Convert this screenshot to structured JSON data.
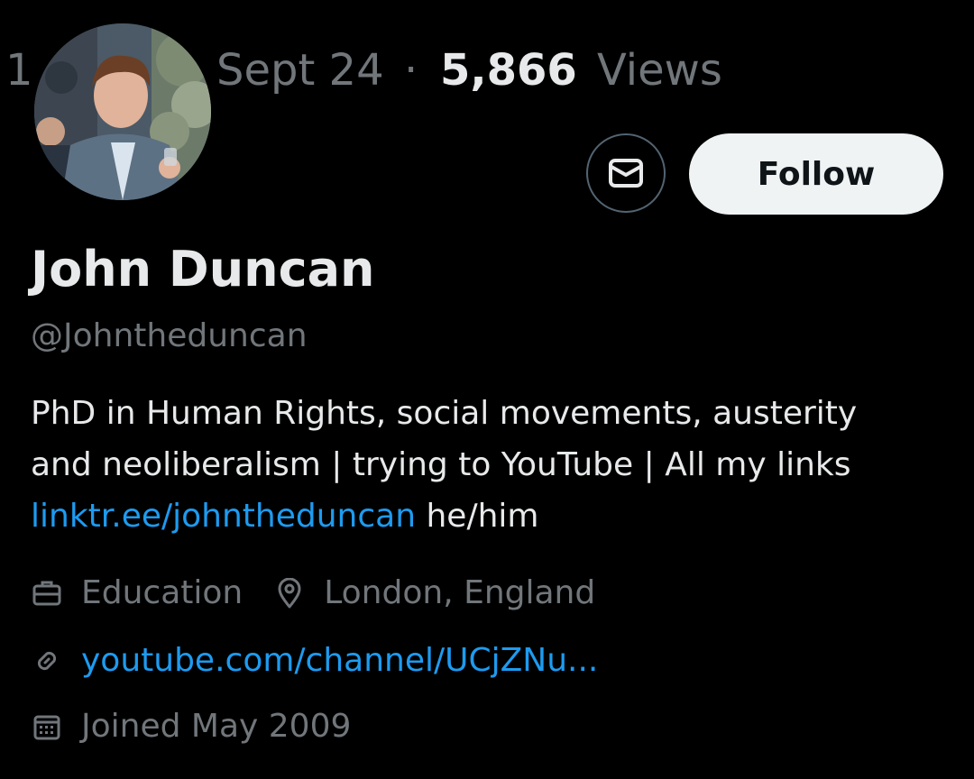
{
  "post_meta": {
    "truncated_time": "1",
    "date": "Sept 24",
    "separator": "·",
    "view_count": "5,866",
    "views_label": "Views"
  },
  "profile": {
    "avatar_icon": "profile-photo",
    "display_name": "John Duncan",
    "handle": "@Johntheduncan",
    "bio": {
      "line1": "PhD in Human Rights, social movements, austerity",
      "line2": "and neoliberalism | trying to YouTube | All my links",
      "link": "linktr.ee/johntheduncan",
      "pronouns": " he/him"
    },
    "info": {
      "category": "Education",
      "location": "London, England",
      "website": "youtube.com/channel/UCjZNu...",
      "joined": "Joined May 2009"
    }
  },
  "actions": {
    "message_icon": "envelope-icon",
    "follow_label": "Follow"
  },
  "colors": {
    "background": "#000000",
    "primary_text": "#e7e9ea",
    "secondary_text": "#71767b",
    "link": "#1d9bf0",
    "follow_bg": "#eff3f4",
    "follow_text": "#0f1419",
    "border": "#536471"
  }
}
